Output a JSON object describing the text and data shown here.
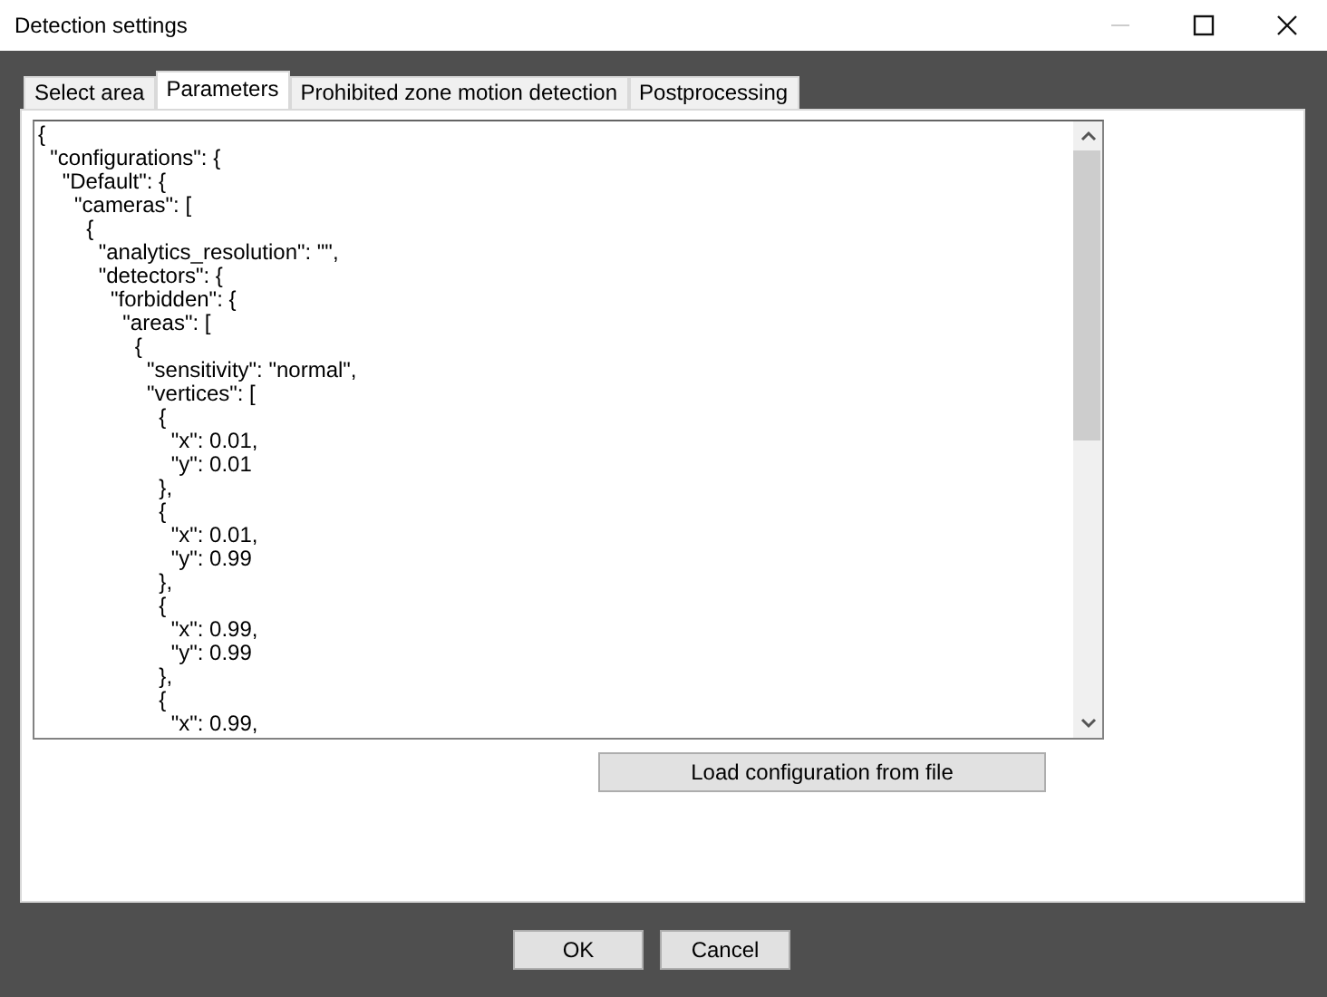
{
  "window": {
    "title": "Detection settings"
  },
  "tabs": [
    {
      "label": "Select area",
      "selected": false
    },
    {
      "label": "Parameters",
      "selected": true
    },
    {
      "label": "Prohibited zone motion detection",
      "selected": false
    },
    {
      "label": "Postprocessing",
      "selected": false
    }
  ],
  "editor": {
    "lines": [
      "{",
      "  \"configurations\": {",
      "    \"Default\": {",
      "      \"cameras\": [",
      "        {",
      "          \"analytics_resolution\": \"\",",
      "          \"detectors\": {",
      "            \"forbidden\": {",
      "              \"areas\": [",
      "                {",
      "                  \"sensitivity\": \"normal\",",
      "                  \"vertices\": [",
      "                    {",
      "                      \"x\": 0.01,",
      "                      \"y\": 0.01",
      "                    },",
      "                    {",
      "                      \"x\": 0.01,",
      "                      \"y\": 0.99",
      "                    },",
      "                    {",
      "                      \"x\": 0.99,",
      "                      \"y\": 0.99",
      "                    },",
      "                    {",
      "                      \"x\": 0.99,"
    ]
  },
  "load_button": "Load configuration from file",
  "buttons": [
    "OK",
    "Cancel"
  ]
}
